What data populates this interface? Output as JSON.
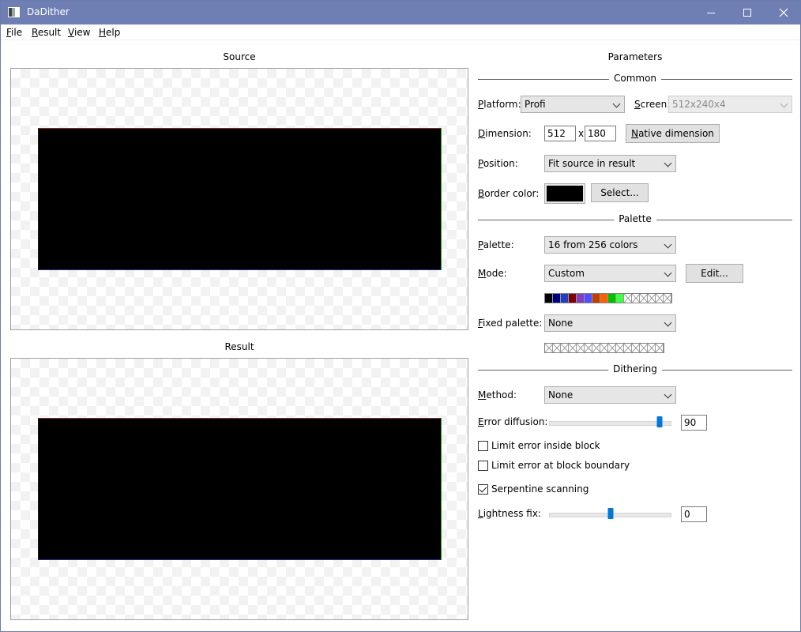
{
  "window": {
    "title": "DaDither",
    "controls": {
      "minimize": "–",
      "maximize": "□",
      "close": "✕"
    }
  },
  "menu": [
    "File",
    "Result",
    "View",
    "Help"
  ],
  "source": {
    "label": "Source"
  },
  "result": {
    "label": "Result"
  },
  "parameters": {
    "title": "Parameters",
    "common": {
      "section": "Common",
      "platform_label": "Platform:",
      "platform_value": "Profi",
      "screen_label": "Screen:",
      "screen_value": "512x240x4",
      "dimension_label": "Dimension:",
      "width": "512",
      "x_sep": "x",
      "height": "180",
      "native_button": "Native dimension",
      "position_label": "Position:",
      "position_value": "Fit source in result",
      "border_label": "Border color:",
      "border_color": "#000000",
      "select_button": "Select..."
    },
    "palette": {
      "section": "Palette",
      "palette_label": "Palette:",
      "palette_value": "16 from 256 colors",
      "mode_label": "Mode:",
      "mode_value": "Custom",
      "edit_button": "Edit...",
      "colors": [
        "#000000",
        "#00007f",
        "#1f3fbf",
        "#7f0000",
        "#7f3fbf",
        "#4f4fff",
        "#bf3f00",
        "#ff5f00",
        "#00bf00",
        "#3fff3f"
      ],
      "empty_slots": 6,
      "fixed_label": "Fixed palette:",
      "fixed_value": "None",
      "fixed_empty_slots": 15
    },
    "dithering": {
      "section": "Dithering",
      "method_label": "Method:",
      "method_value": "None",
      "error_label": "Error diffusion:",
      "error_value": "90",
      "error_level": 0.9,
      "limit_inside_label": "Limit error inside block",
      "limit_inside_checked": false,
      "limit_boundary_label": "Limit error at block boundary",
      "limit_boundary_checked": false,
      "serpentine_label": "Serpentine scanning",
      "serpentine_checked": true,
      "lightness_label": "Lightness fix:",
      "lightness_value": "0",
      "lightness_level": 0.5
    }
  }
}
